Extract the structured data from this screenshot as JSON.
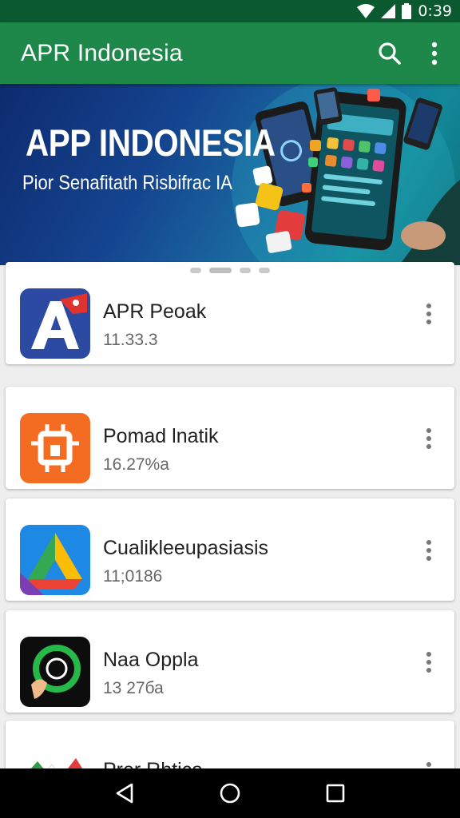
{
  "status_bar": {
    "time": "0:39"
  },
  "app_bar": {
    "title": "APR Indonesia"
  },
  "banner": {
    "title": "APP INDONESIA",
    "subtitle": "Pior Senafitath Risbifrac IA"
  },
  "carousel": {
    "pages": 4,
    "active_index": 1
  },
  "apps": [
    {
      "name": "APR Peoak",
      "size": "11.33.3"
    },
    {
      "name": "Pomad lnatik",
      "size": "16.27%a"
    },
    {
      "name": "Cualikleeupasiasis",
      "size": "11;0186"
    },
    {
      "name": "Naa Oppla",
      "size": "13 27ба"
    },
    {
      "name": "Prer Rhtica",
      "size": ""
    }
  ],
  "colors": {
    "status_bar": "#0b5a2f",
    "app_bar": "#1e874a",
    "nav_bar": "#000000"
  },
  "icons": {
    "search": "search-icon",
    "more": "more-vert-icon",
    "back": "back-triangle-icon",
    "home": "home-circle-icon",
    "recents": "recents-square-icon"
  }
}
